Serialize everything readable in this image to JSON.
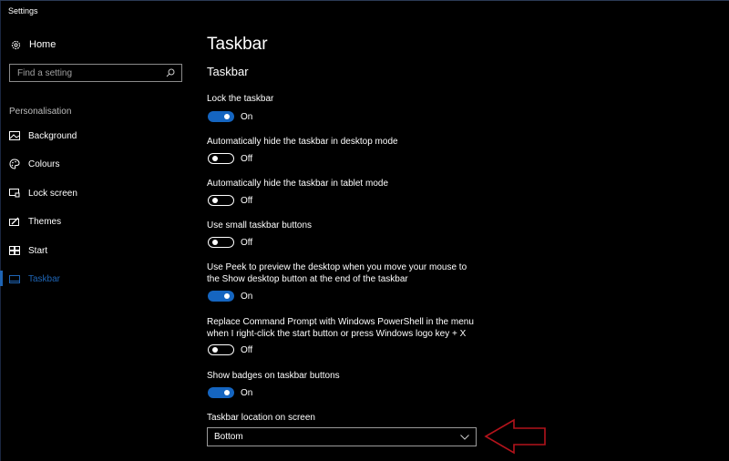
{
  "window": {
    "title": "Settings"
  },
  "sidebar": {
    "home_label": "Home",
    "search": {
      "placeholder": "Find a setting",
      "value": ""
    },
    "section_label": "Personalisation",
    "items": [
      {
        "label": "Background",
        "icon": "picture-icon"
      },
      {
        "label": "Colours",
        "icon": "palette-icon"
      },
      {
        "label": "Lock screen",
        "icon": "lock-screen-icon"
      },
      {
        "label": "Themes",
        "icon": "themes-icon"
      },
      {
        "label": "Start",
        "icon": "start-icon"
      },
      {
        "label": "Taskbar",
        "icon": "taskbar-icon",
        "active": true
      }
    ]
  },
  "main": {
    "page_title": "Taskbar",
    "section_title": "Taskbar",
    "settings": [
      {
        "label": "Lock the taskbar",
        "state": "On"
      },
      {
        "label": "Automatically hide the taskbar in desktop mode",
        "state": "Off"
      },
      {
        "label": "Automatically hide the taskbar in tablet mode",
        "state": "Off"
      },
      {
        "label": "Use small taskbar buttons",
        "state": "Off"
      },
      {
        "label": "Use Peek to preview the desktop when you move your mouse to the Show desktop button at the end of the taskbar",
        "state": "On"
      },
      {
        "label": "Replace Command Prompt with Windows PowerShell in the menu when I right-click the start button or press Windows logo key + X",
        "state": "Off"
      },
      {
        "label": "Show badges on taskbar buttons",
        "state": "On"
      }
    ],
    "location": {
      "label": "Taskbar location on screen",
      "value": "Bottom"
    }
  },
  "colors": {
    "accent": "#1565c0",
    "annotation_arrow": "#b3131b"
  }
}
